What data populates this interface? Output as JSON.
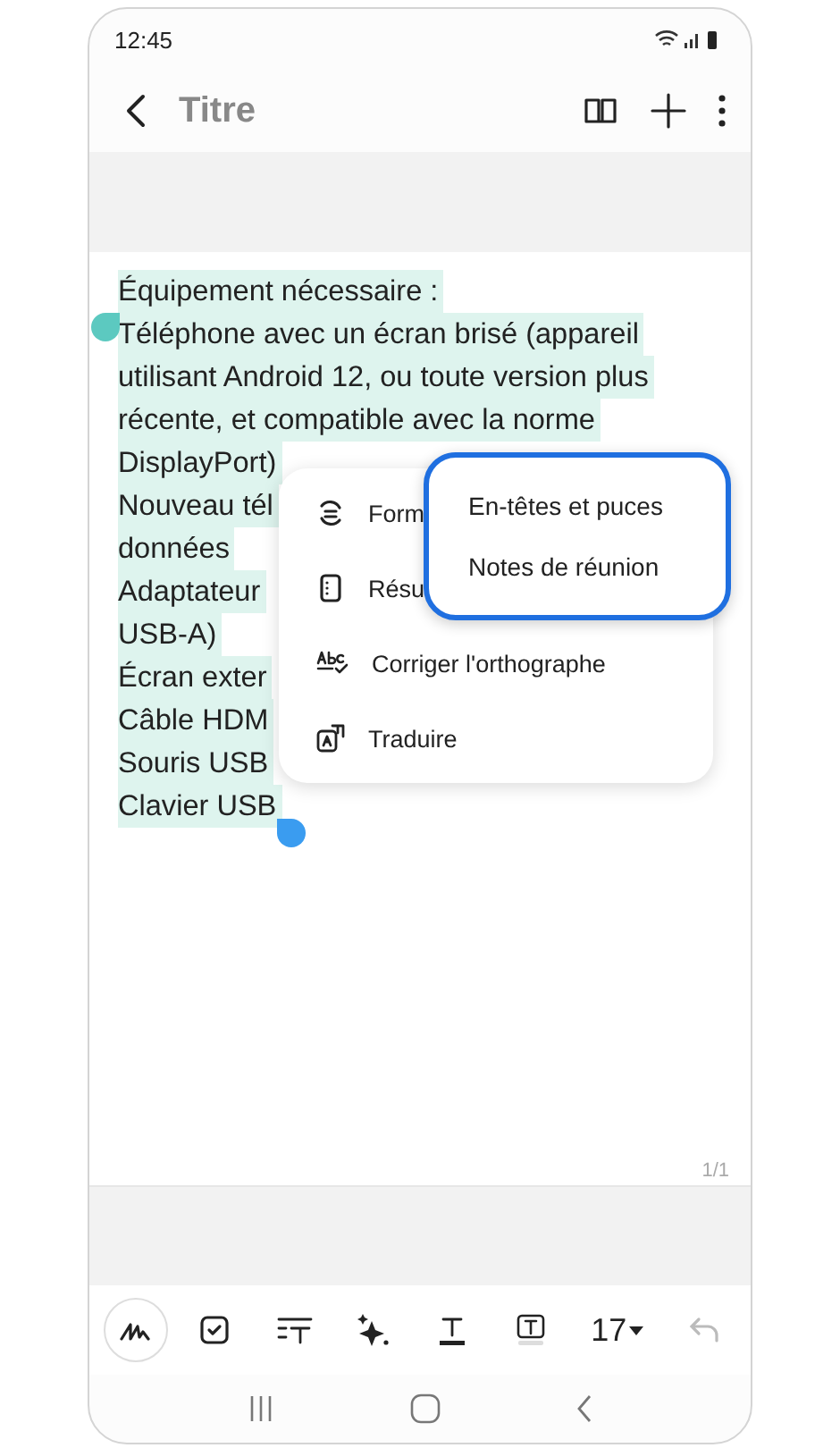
{
  "status_bar": {
    "time": "12:45"
  },
  "app_bar": {
    "title": "Titre"
  },
  "note": {
    "lines": [
      "Équipement nécessaire :",
      "Téléphone avec un écran brisé (appareil",
      "utilisant Android 12, ou toute version plus",
      "récente, et compatible avec la norme",
      "DisplayPort)",
      "Nouveau tél",
      "données",
      "Adaptateur",
      "USB-A)",
      "Écran exter",
      "Câble HDM",
      "Souris USB",
      "Clavier USB"
    ],
    "page": "1/1"
  },
  "menu": {
    "items": [
      {
        "kind": "format",
        "label": "Form"
      },
      {
        "kind": "summary",
        "label": "Résu"
      },
      {
        "kind": "spelling",
        "label": "Corriger l'orthographe"
      },
      {
        "kind": "translate",
        "label": "Traduire"
      }
    ]
  },
  "submenu": {
    "items": [
      "En-têtes et puces",
      "Notes de réunion"
    ]
  },
  "toolbar": {
    "font_size": "17"
  }
}
